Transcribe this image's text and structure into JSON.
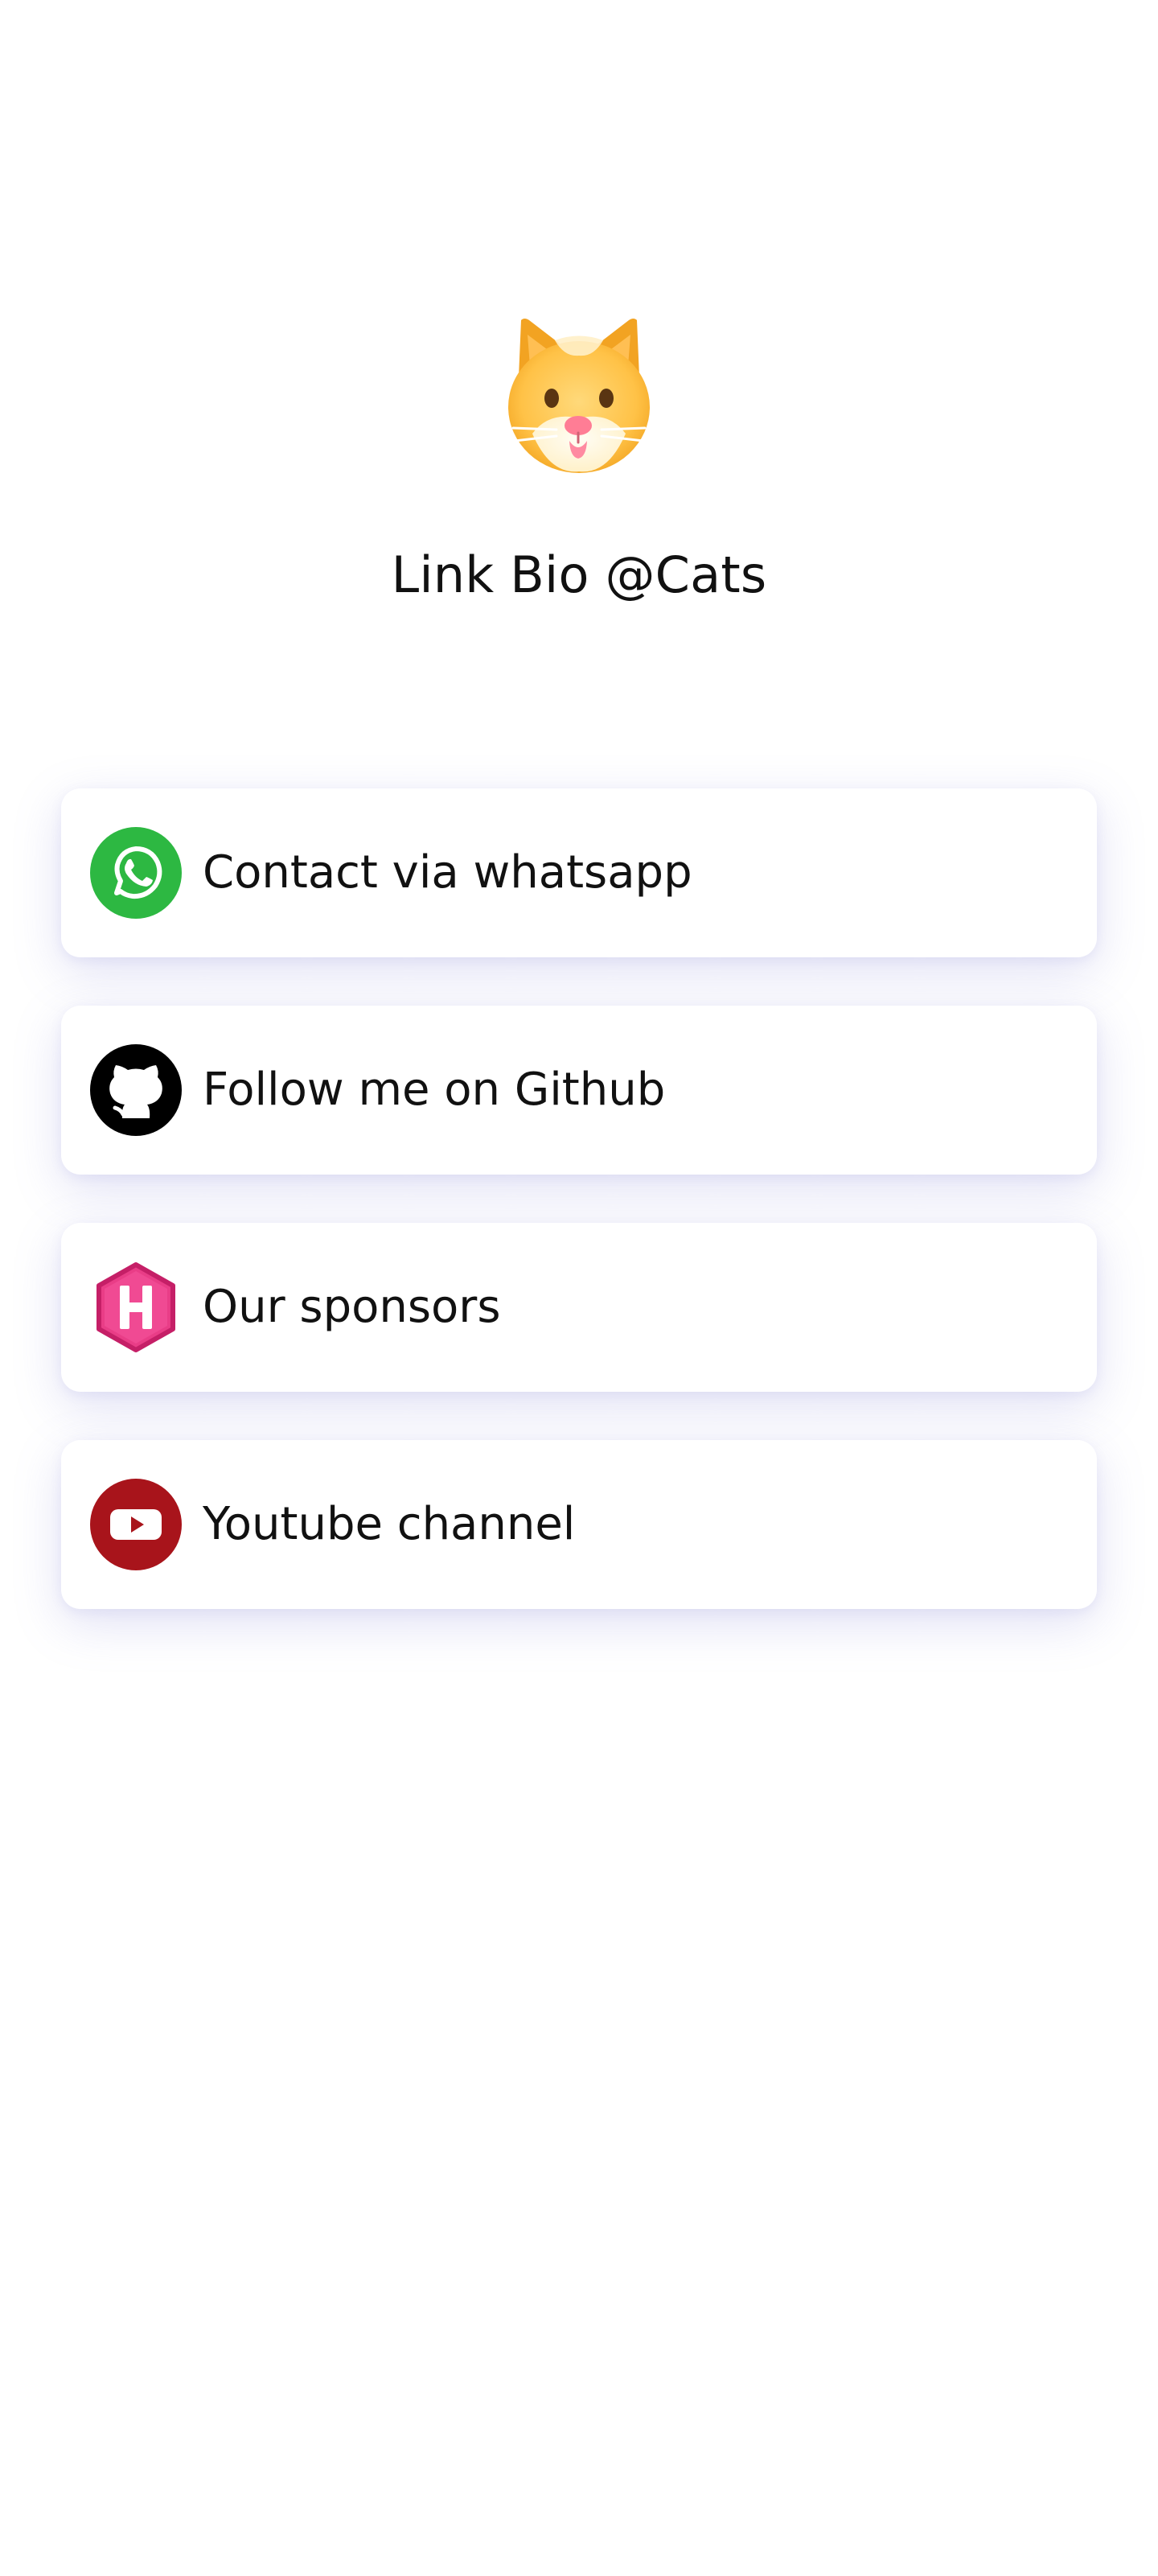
{
  "profile": {
    "avatar_icon": "cat-face-icon",
    "title": "Link Bio @Cats"
  },
  "links": [
    {
      "label": "Contact via whatsapp",
      "icon": "whatsapp-icon",
      "color": "#2db842"
    },
    {
      "label": "Follow me on Github",
      "icon": "github-icon",
      "color": "#000000"
    },
    {
      "label": "Our sponsors",
      "icon": "hashnode-icon",
      "color": "#e93d87"
    },
    {
      "label": "Youtube channel",
      "icon": "youtube-icon",
      "color": "#a8141b"
    }
  ],
  "colors": {
    "background": "#ffffff",
    "text": "#111111",
    "card_shadow": "#e9e9f8"
  }
}
